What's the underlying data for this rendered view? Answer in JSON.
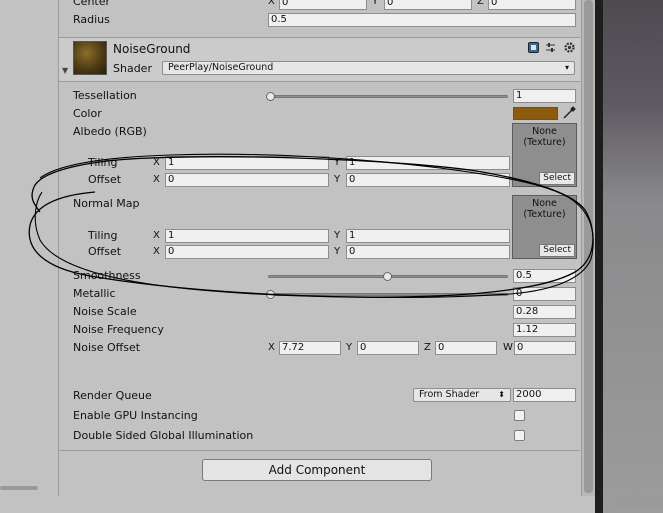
{
  "sphere_collider": {
    "center_label": "Center",
    "center": {
      "x_label": "X",
      "x": "0",
      "y_label": "Y",
      "y": "0",
      "z_label": "Z",
      "z": "0"
    },
    "radius_label": "Radius",
    "radius": "0.5"
  },
  "material": {
    "name": "NoiseGround",
    "shader_label": "Shader",
    "shader_value": "PeerPlay/NoiseGround",
    "dropdown_arrow": "▾"
  },
  "properties": {
    "tessellation_label": "Tessellation",
    "tessellation_value": "1",
    "tessellation_level": 0.0,
    "color_label": "Color",
    "color_hex": "#8b5c0e",
    "albedo_label": "Albedo (RGB)",
    "tex_none": "None",
    "tex_type": "(Texture)",
    "select_label": "Select",
    "tiling_label": "Tiling",
    "offset_label": "Offset",
    "x_label": "X",
    "y_label": "Y",
    "z_label": "Z",
    "w_label": "W",
    "albedo_tiling": {
      "x": "1",
      "y": "1"
    },
    "albedo_offset": {
      "x": "0",
      "y": "0"
    },
    "normal_label": "Normal Map",
    "normal_tiling": {
      "x": "1",
      "y": "1"
    },
    "normal_offset": {
      "x": "0",
      "y": "0"
    },
    "smoothness_label": "Smoothness",
    "smoothness_value": "0.5",
    "smoothness_level": 0.5,
    "metallic_label": "Metallic",
    "metallic_value": "0",
    "metallic_level": 0.0,
    "noise_scale_label": "Noise Scale",
    "noise_scale_value": "0.28",
    "noise_freq_label": "Noise Frequency",
    "noise_freq_value": "1.12",
    "noise_offset_label": "Noise Offset",
    "noise_offset": {
      "x": "7.72",
      "y": "0",
      "z": "0",
      "w": "0"
    },
    "render_queue_label": "Render Queue",
    "render_queue_mode": "From Shader",
    "render_queue_value": "2000",
    "gpu_instancing_label": "Enable GPU Instancing",
    "double_sided_gi_label": "Double Sided Global Illumination"
  },
  "add_component_label": "Add Component",
  "icons": {
    "book": "book-icon",
    "settings_sliders": "preset-icon",
    "gear": "gear-icon",
    "eyedropper": "eyedropper-icon",
    "foldout": "foldout-arrow-icon"
  },
  "colors": {
    "inspector_bg": "#c2c2c2",
    "swatch": "#8b5c0e",
    "annotation": "#000000"
  }
}
